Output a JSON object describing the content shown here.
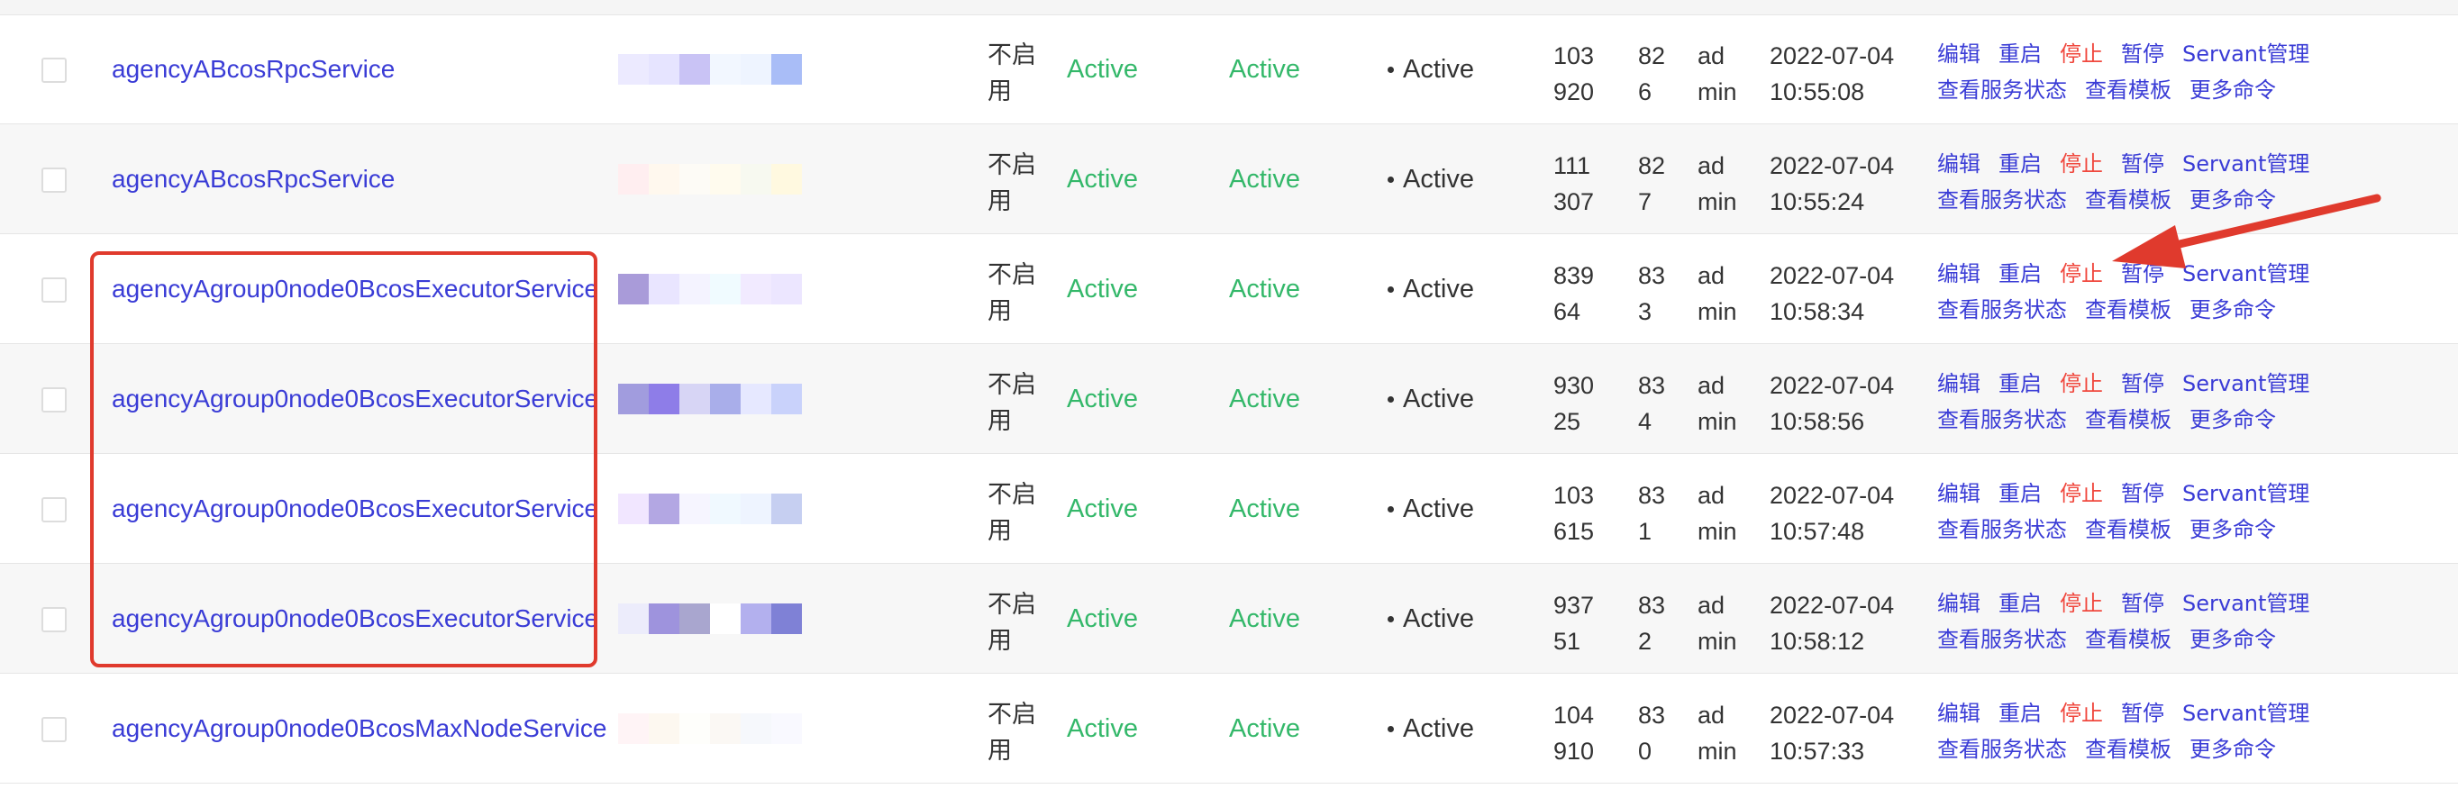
{
  "colors": {
    "link": "#3a3cd6",
    "danger": "#f0483e",
    "status_green": "#34b86a",
    "annotation_red": "#e03a2d"
  },
  "rows": [
    {
      "name": "agencyABcosRpcService",
      "setting": "不启用",
      "setting_line1": "不启",
      "setting_line2": "用",
      "setting_state": "Active",
      "set_state": "Active",
      "present_state": "Active",
      "pid_line1": "103",
      "pid_line2": "920",
      "ver_line1": "82",
      "ver_line2": "6",
      "user_line1": "ad",
      "user_line2": "min",
      "date": "2022-07-04",
      "time": "10:55:08"
    },
    {
      "name": "agencyABcosRpcService",
      "setting_line1": "不启",
      "setting_line2": "用",
      "setting_state": "Active",
      "set_state": "Active",
      "present_state": "Active",
      "pid_line1": "111",
      "pid_line2": "307",
      "ver_line1": "82",
      "ver_line2": "7",
      "user_line1": "ad",
      "user_line2": "min",
      "date": "2022-07-04",
      "time": "10:55:24"
    },
    {
      "name": "agencyAgroup0node0BcosExecutorService",
      "setting_line1": "不启",
      "setting_line2": "用",
      "setting_state": "Active",
      "set_state": "Active",
      "present_state": "Active",
      "pid_line1": "839",
      "pid_line2": "64",
      "ver_line1": "83",
      "ver_line2": "3",
      "user_line1": "ad",
      "user_line2": "min",
      "date": "2022-07-04",
      "time": "10:58:34"
    },
    {
      "name": "agencyAgroup0node0BcosExecutorService",
      "setting_line1": "不启",
      "setting_line2": "用",
      "setting_state": "Active",
      "set_state": "Active",
      "present_state": "Active",
      "pid_line1": "930",
      "pid_line2": "25",
      "ver_line1": "83",
      "ver_line2": "4",
      "user_line1": "ad",
      "user_line2": "min",
      "date": "2022-07-04",
      "time": "10:58:56"
    },
    {
      "name": "agencyAgroup0node0BcosExecutorService",
      "setting_line1": "不启",
      "setting_line2": "用",
      "setting_state": "Active",
      "set_state": "Active",
      "present_state": "Active",
      "pid_line1": "103",
      "pid_line2": "615",
      "ver_line1": "83",
      "ver_line2": "1",
      "user_line1": "ad",
      "user_line2": "min",
      "date": "2022-07-04",
      "time": "10:57:48"
    },
    {
      "name": "agencyAgroup0node0BcosExecutorService",
      "setting_line1": "不启",
      "setting_line2": "用",
      "setting_state": "Active",
      "set_state": "Active",
      "present_state": "Active",
      "pid_line1": "937",
      "pid_line2": "51",
      "ver_line1": "83",
      "ver_line2": "2",
      "user_line1": "ad",
      "user_line2": "min",
      "date": "2022-07-04",
      "time": "10:58:12"
    },
    {
      "name": "agencyAgroup0node0BcosMaxNodeService",
      "setting_line1": "不启",
      "setting_line2": "用",
      "setting_state": "Active",
      "set_state": "Active",
      "present_state": "Active",
      "pid_line1": "104",
      "pid_line2": "910",
      "ver_line1": "83",
      "ver_line2": "0",
      "user_line1": "ad",
      "user_line2": "min",
      "date": "2022-07-04",
      "time": "10:57:33"
    }
  ],
  "actions": {
    "edit": "编辑",
    "restart": "重启",
    "stop": "停止",
    "pause": "暂停",
    "servant_manage": "Servant管理",
    "view_status": "查看服务状态",
    "view_template": "查看模板",
    "more_commands": "更多命令"
  },
  "mask_colors": [
    [
      "#eceaff",
      "#e6e4ff",
      "#c9c3f5",
      "#f2f7ff",
      "#eef4ff",
      "#a9bdf7"
    ],
    [
      "#ffeef0",
      "#fff8ee",
      "#fdfbf6",
      "#fffbee",
      "#f7f9f0",
      "#fff9e0"
    ],
    [
      "#a99bd9",
      "#e9e5ff",
      "#f4f3ff",
      "#f0fbff",
      "#f1eaff",
      "#ece6ff"
    ],
    [
      "#a19cde",
      "#8e7de8",
      "#d7d5f5",
      "#a9aeea",
      "#e6e8ff",
      "#c9d2fb"
    ],
    [
      "#f1e6ff",
      "#b3a7e3",
      "#f6f5ff",
      "#f0f9ff",
      "#eef4ff",
      "#c6cff1"
    ],
    [
      "#ececfb",
      "#9e93dd",
      "#a9a6cf",
      "#ffffff",
      "#b3b0ee",
      "#7f81d6"
    ],
    [
      "#fff4f6",
      "#fdf8f0",
      "#fefefb",
      "#fbf8f4",
      "#f6f8fc",
      "#f9f9ff"
    ]
  ]
}
